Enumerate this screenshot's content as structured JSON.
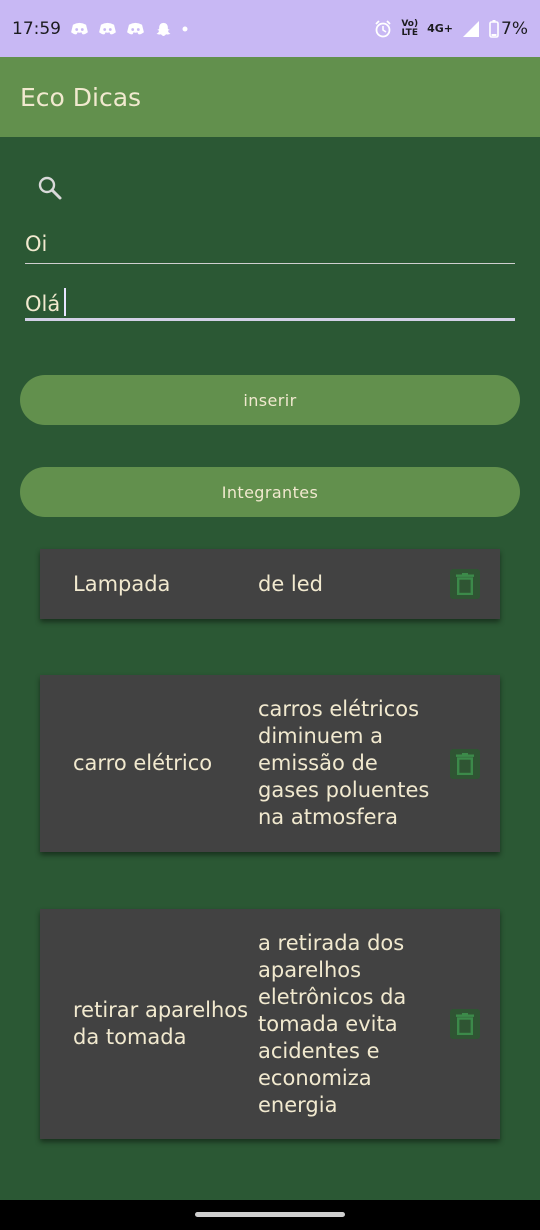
{
  "status_bar": {
    "time": "17:59",
    "lte_top": "Vo)",
    "lte_bottom": "LTE",
    "network": "4G+",
    "battery": "7%"
  },
  "app_bar": {
    "title": "Eco Dicas"
  },
  "form": {
    "field1_value": "Oi",
    "field2_value": "Olá"
  },
  "buttons": {
    "insert_label": "inserir",
    "members_label": "Integrantes"
  },
  "tips": [
    {
      "name": "Lampada",
      "description": "de led"
    },
    {
      "name": "carro elétrico",
      "description": "carros elétricos diminuem a emissão de gases poluentes na atmosfera"
    },
    {
      "name": "retirar aparelhos da tomada",
      "description": "a retirada dos aparelhos eletrônicos da tomada evita acidentes e economiza energia"
    }
  ],
  "icons": {
    "search": "search-icon",
    "delete": "trash-icon"
  },
  "colors": {
    "status_bar": "#c8b8f4",
    "app_bar": "#62904d",
    "background": "#2b5834",
    "card": "#424242",
    "text": "#f1e9cf",
    "trash_icon": "#3c8a4a"
  }
}
